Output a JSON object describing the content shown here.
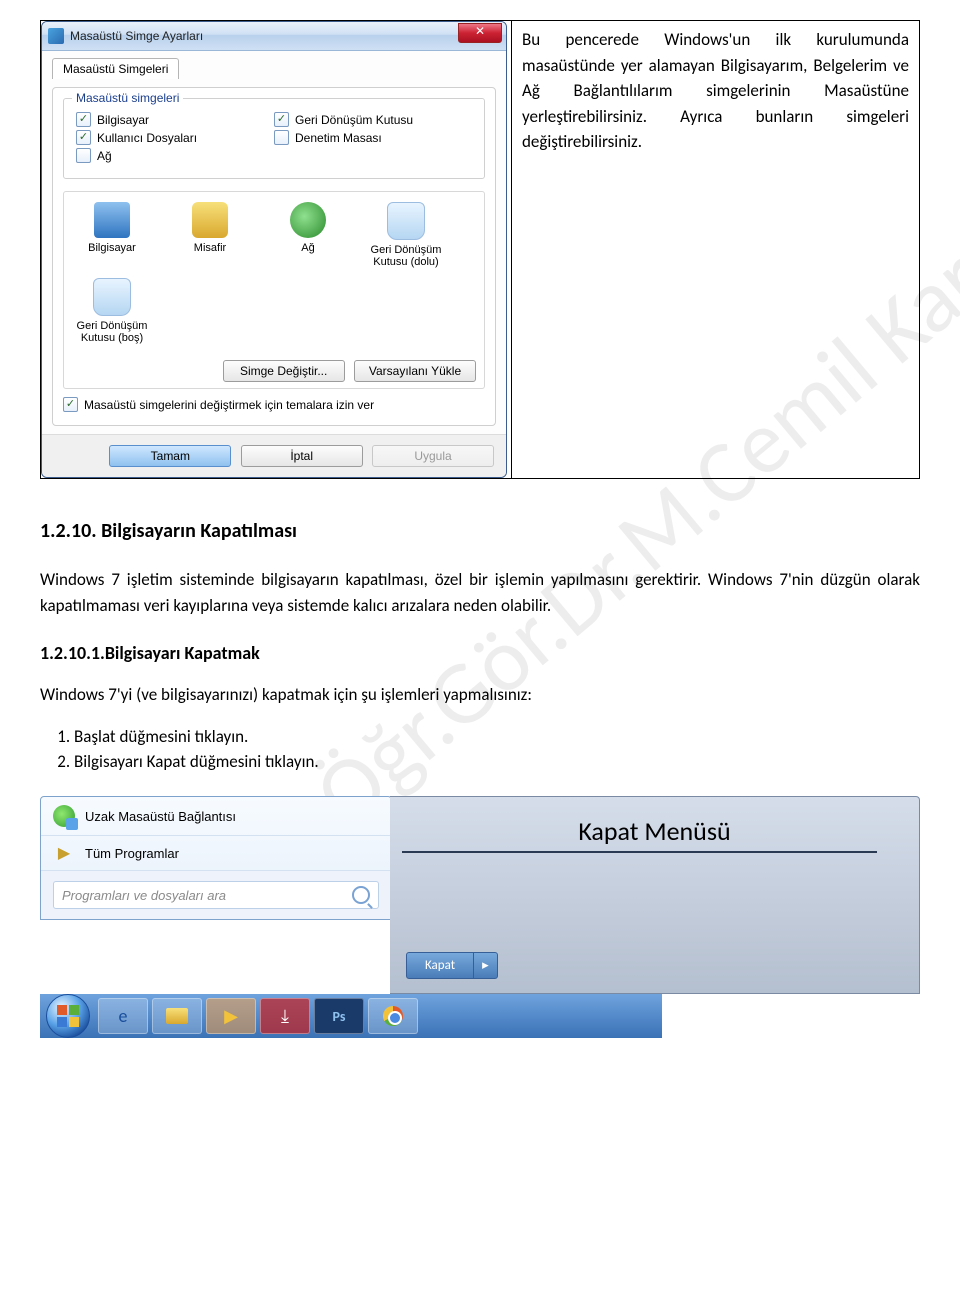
{
  "watermark": "Öğr.Gör.Dr.M.Cemil Karacadağ",
  "dialog": {
    "title": "Masaüstü Simge Ayarları",
    "tab": "Masaüstü Simgeleri",
    "group_title": "Masaüstü simgeleri",
    "cb_bilgisayar": "Bilgisayar",
    "cb_kullanici": "Kullanıcı Dosyaları",
    "cb_ag": "Ağ",
    "cb_geri": "Geri Dönüşüm Kutusu",
    "cb_denetim": "Denetim Masası",
    "icon_bilgisayar": "Bilgisayar",
    "icon_misafir": "Misafir",
    "icon_ag": "Ağ",
    "icon_geri_dolu": "Geri Dönüşüm Kutusu (dolu)",
    "icon_geri_bos": "Geri Dönüşüm Kutusu (boş)",
    "btn_degistir": "Simge Değiştir...",
    "btn_varsayilan": "Varsayılanı Yükle",
    "cb_allow": "Masaüstü simgelerini değiştirmek için temalara izin ver",
    "btn_tamam": "Tamam",
    "btn_iptal": "İptal",
    "btn_uygula": "Uygula"
  },
  "right_text": "Bu pencerede Windows'un ilk kurulumunda masaüstünde yer alamayan Bilgisayarım, Belgelerim ve Ağ Bağlantılılarım simgelerinin Masaüstüne yerleştirebilirsiniz. Ayrıca bunların simgeleri değiştirebilirsiniz.",
  "h_1210": "1.2.10. Bilgisayarın Kapatılması",
  "para_1": "Windows 7 işletim sisteminde bilgisayarın kapatılması, özel bir işlemin yapılmasını gerektirir. Windows 7'nin düzgün olarak kapatılmaması veri kayıplarına veya sistemde kalıcı arızalara neden olabilir.",
  "h_12101": "1.2.10.1.Bilgisayarı Kapatmak",
  "para_2": "Windows 7'yi (ve bilgisayarınızı) kapatmak için şu işlemleri yapmalısınız:",
  "step1": "Başlat düğmesini tıklayın.",
  "step2": "Bilgisayarı Kapat düğmesini tıklayın.",
  "startmenu": {
    "rdp": "Uzak Masaüstü Bağlantısı",
    "allprograms": "Tüm Programlar",
    "search_placeholder": "Programları ve dosyaları ara",
    "kapat_title": "Kapat Menüsü",
    "kapat_btn": "Kapat"
  }
}
